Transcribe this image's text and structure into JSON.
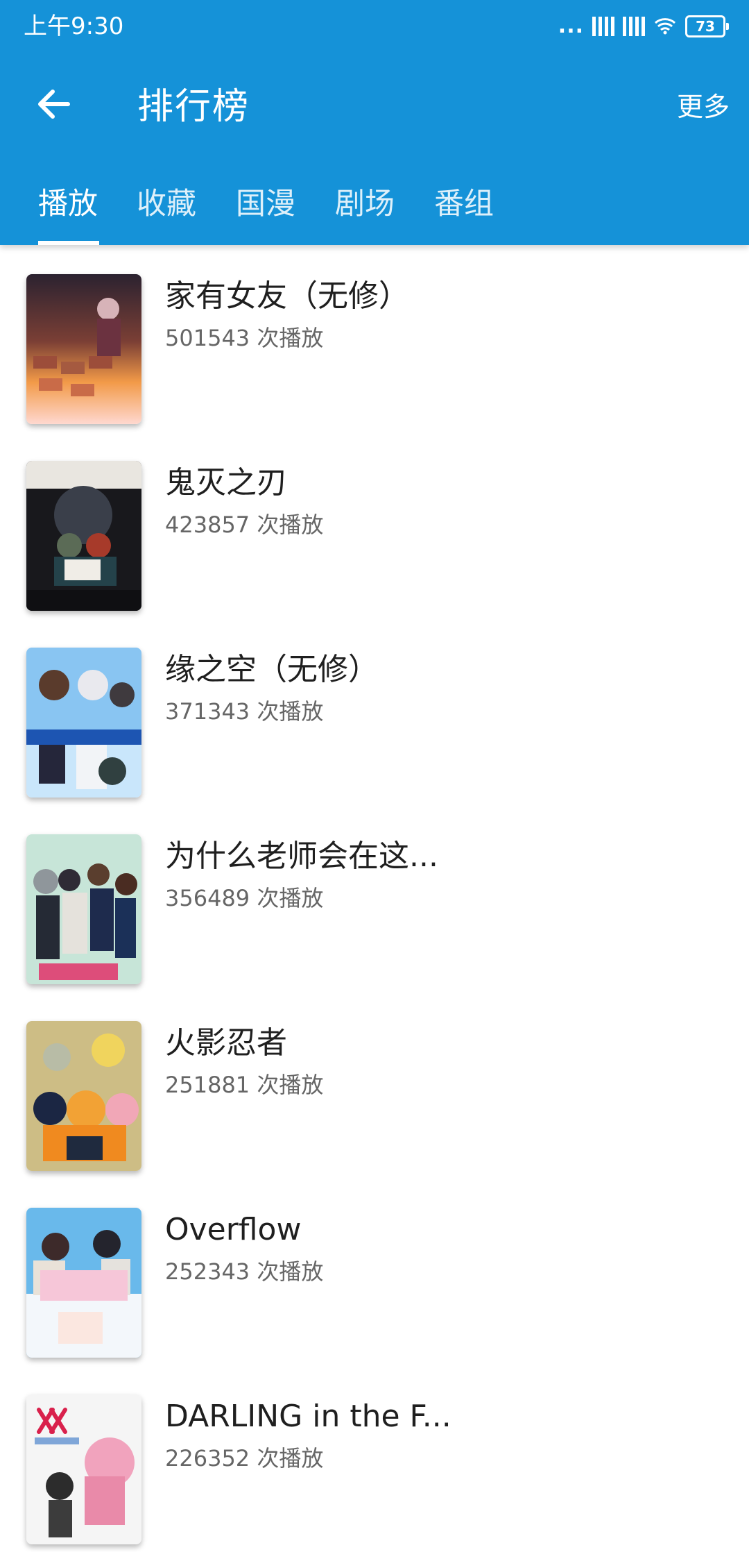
{
  "status_bar": {
    "time": "上午9:30",
    "battery": "73",
    "icons": [
      "more-dots-icon",
      "signal-icon",
      "signal-icon",
      "wifi-icon",
      "battery-icon"
    ]
  },
  "app_bar": {
    "back_icon": "arrow-left-icon",
    "title": "排行榜",
    "more_label": "更多",
    "accent_color": "#1592d8"
  },
  "tabs": [
    {
      "label": "播放",
      "active": true
    },
    {
      "label": "收藏",
      "active": false
    },
    {
      "label": "国漫",
      "active": false
    },
    {
      "label": "剧场",
      "active": false
    },
    {
      "label": "番组",
      "active": false
    }
  ],
  "items": [
    {
      "title": "家有女友（无修）",
      "plays": "501543 次播放"
    },
    {
      "title": "鬼灭之刃",
      "plays": "423857 次播放"
    },
    {
      "title": "缘之空（无修）",
      "plays": "371343 次播放"
    },
    {
      "title": "为什么老师会在这...",
      "plays": "356489 次播放"
    },
    {
      "title": "火影忍者",
      "plays": "251881 次播放"
    },
    {
      "title": "Overflow",
      "plays": "252343 次播放"
    },
    {
      "title": "DARLING in the F...",
      "plays": "226352 次播放"
    }
  ]
}
